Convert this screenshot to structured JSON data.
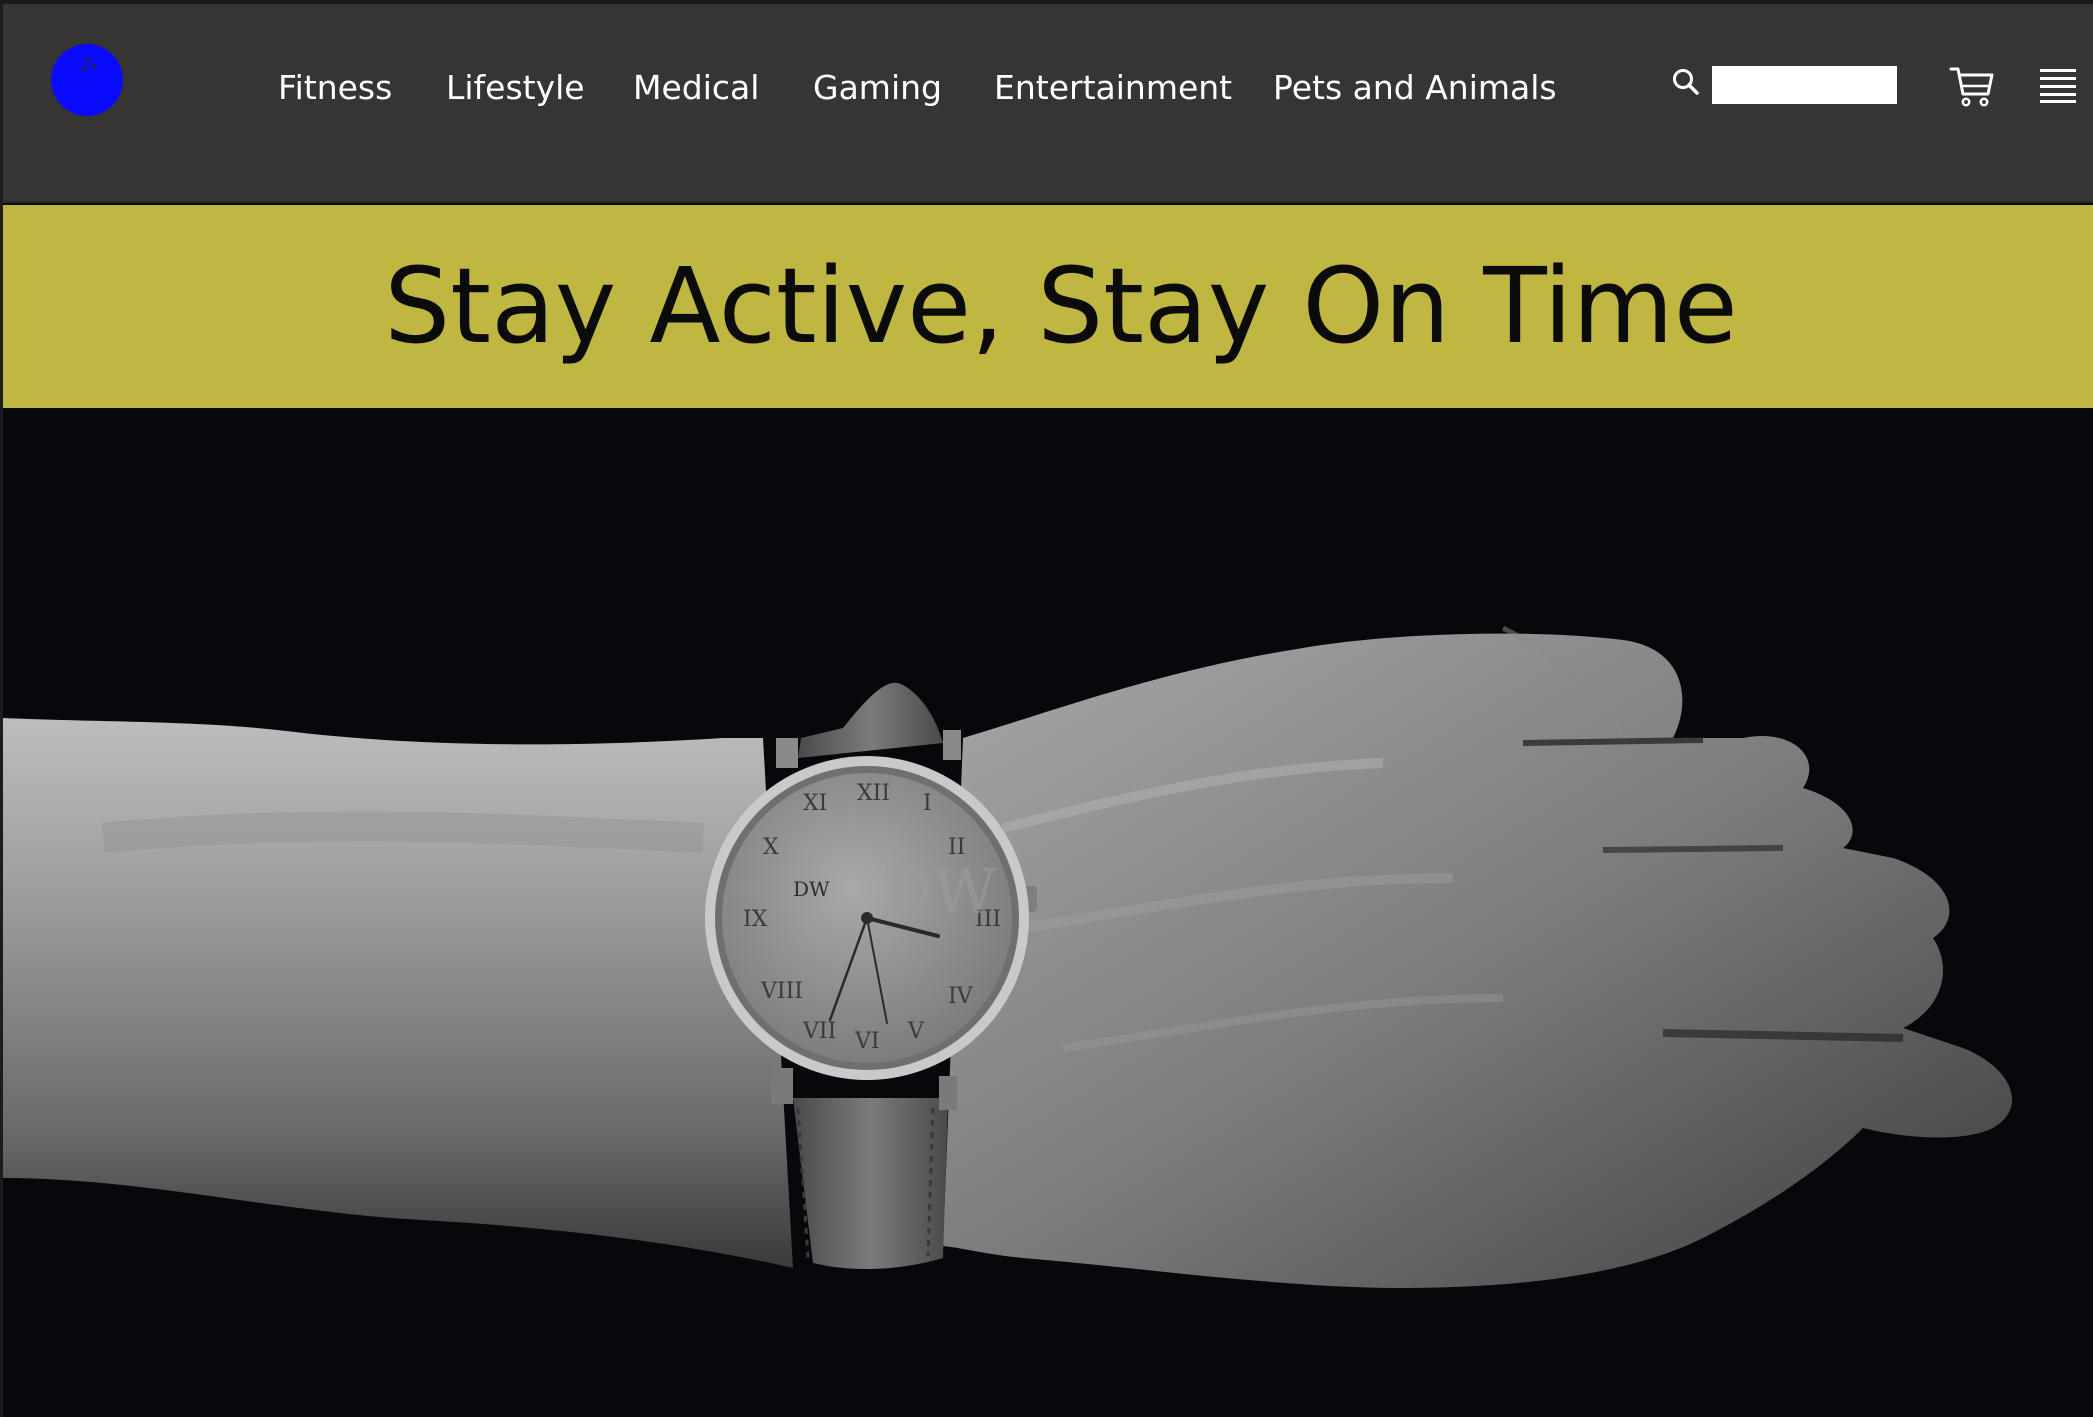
{
  "header": {
    "logo_icon": "logo-icon",
    "nav_items": [
      "Fitness",
      "Lifestyle",
      "Medical",
      "Gaming",
      "Entertainment",
      "Pets and Animals"
    ],
    "search_icon": "search-icon",
    "search": {
      "value": "",
      "placeholder": ""
    },
    "cart_icon": "cart-icon",
    "menu_icon": "hamburger-menu-icon"
  },
  "banner": {
    "title": "Stay Active, Stay On Time"
  },
  "hero": {
    "image": "black-and-white-photo-of-arm-wearing-wristwatch",
    "watch_brand": "DW"
  },
  "colors": {
    "header_bg": "#363534",
    "banner_bg": "#c0b642",
    "hero_bg": "#07080b",
    "logo": "#0a0aff",
    "nav_text": "#ffffff",
    "title_text": "#0b0b0b"
  }
}
